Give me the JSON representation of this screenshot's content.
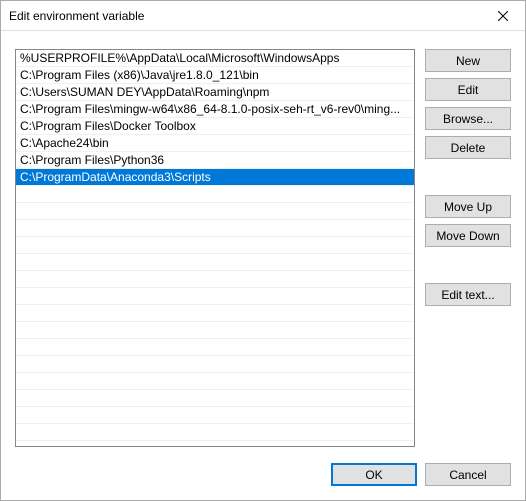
{
  "titlebar": {
    "title": "Edit environment variable"
  },
  "list": {
    "items": [
      "%USERPROFILE%\\AppData\\Local\\Microsoft\\WindowsApps",
      "C:\\Program Files (x86)\\Java\\jre1.8.0_121\\bin",
      "C:\\Users\\SUMAN DEY\\AppData\\Roaming\\npm",
      "C:\\Program Files\\mingw-w64\\x86_64-8.1.0-posix-seh-rt_v6-rev0\\ming...",
      "C:\\Program Files\\Docker Toolbox",
      "C:\\Apache24\\bin",
      "C:\\Program Files\\Python36",
      "C:\\ProgramData\\Anaconda3\\Scripts"
    ],
    "selected_index": 7
  },
  "buttons": {
    "new": "New",
    "edit": "Edit",
    "browse": "Browse...",
    "delete": "Delete",
    "move_up": "Move Up",
    "move_down": "Move Down",
    "edit_text": "Edit text...",
    "ok": "OK",
    "cancel": "Cancel"
  }
}
